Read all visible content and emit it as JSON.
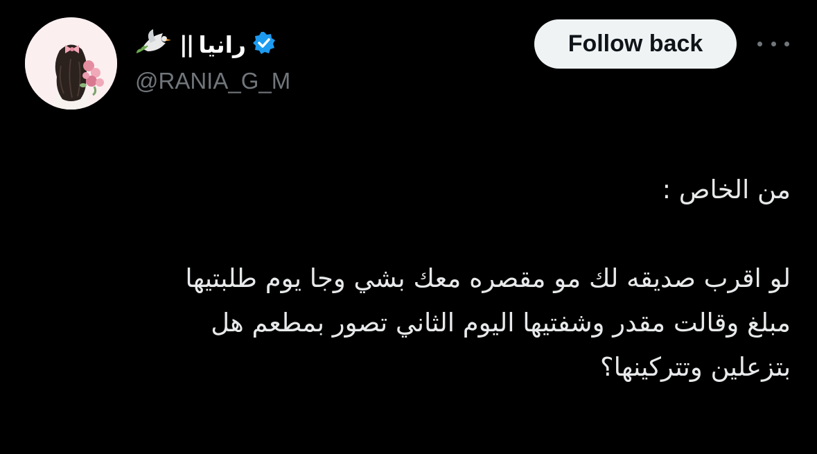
{
  "author": {
    "name": "رانيا",
    "separator": "||",
    "emoji_icon": "dove-with-olive-branch-icon",
    "verified_icon": "verified-badge-icon",
    "handle": "@RANIA_G_M",
    "avatar_icon": "girl-with-flowers-avatar"
  },
  "actions": {
    "follow_label": "Follow back",
    "more_icon": "more-options-icon"
  },
  "tweet": {
    "line1": "من الخاص :",
    "line2": "لو اقرب صديقه لك مو مقصره معك بشي وجا يوم طلبتيها",
    "line3": "مبلغ وقالت مقدر وشفتيها اليوم الثاني تصور بمطعم هل",
    "line4": "بتزعلين وتتركينها؟"
  },
  "colors": {
    "background": "#000000",
    "text": "#e7e9ea",
    "secondary": "#71767b",
    "verified": "#1d9bf0",
    "button_bg": "#eff3f4"
  }
}
